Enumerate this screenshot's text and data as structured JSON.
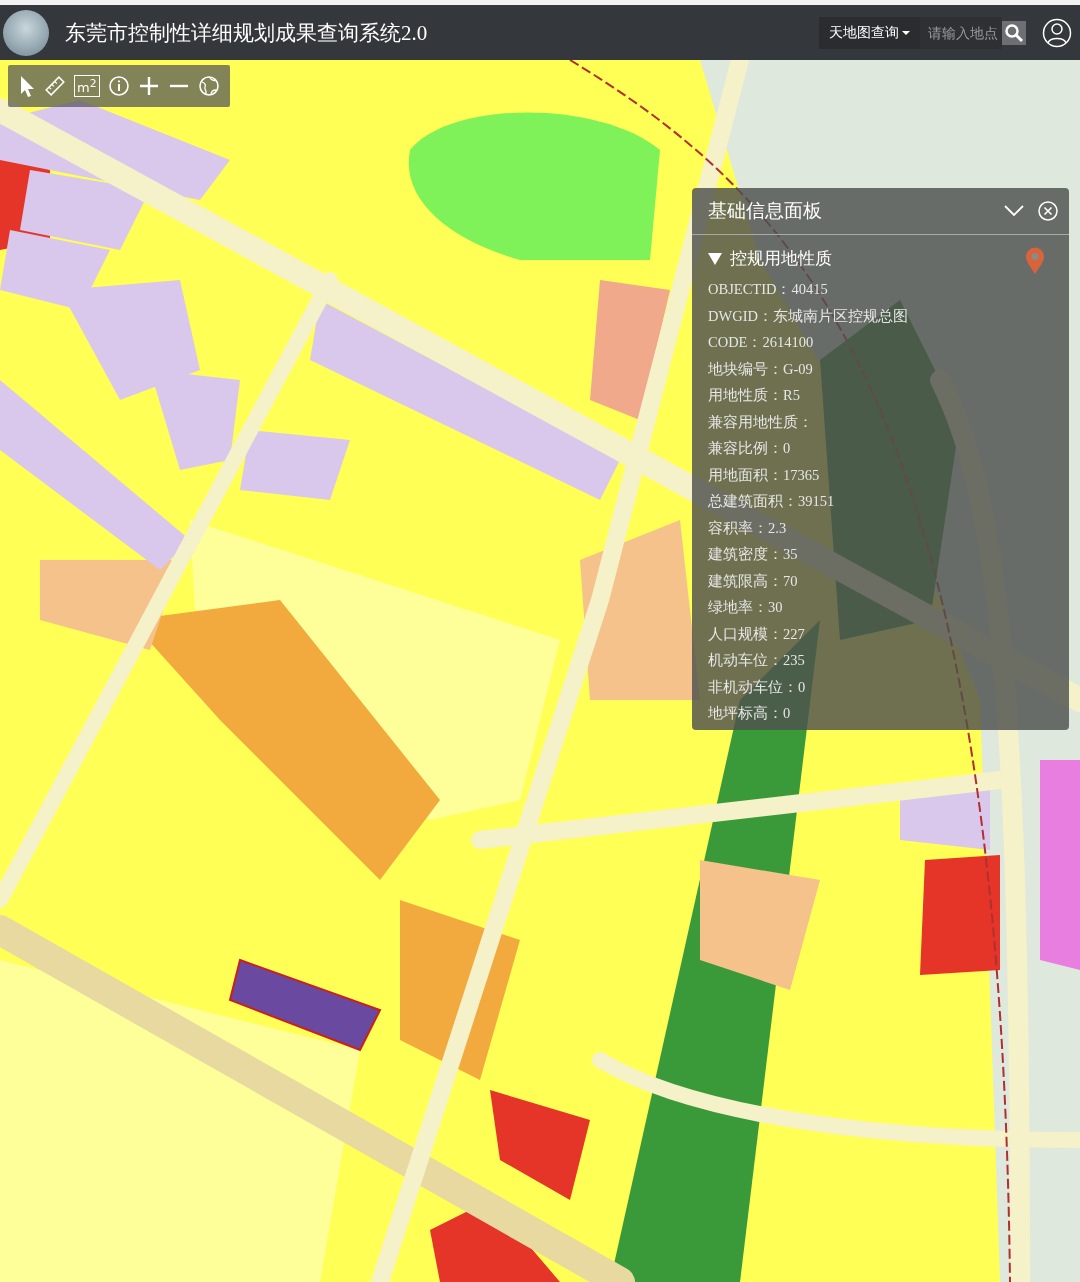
{
  "header": {
    "title": "东莞市控制性详细规划成果查询系统2.0",
    "search_mode": "天地图查询",
    "search": {
      "placeholder": "请输入地点"
    }
  },
  "toolbar": {
    "tools": [
      {
        "kind": "pointer"
      },
      {
        "kind": "ruler"
      },
      {
        "kind": "area",
        "label": "m$^{2}$"
      },
      {
        "kind": "info"
      },
      {
        "kind": "zoom-in"
      },
      {
        "kind": "zoom-out"
      },
      {
        "kind": "globe"
      }
    ]
  },
  "info_panel": {
    "title": "基础信息面板",
    "section": {
      "title": "控规用地性质",
      "expanded": true,
      "fields": [
        {
          "label": "OBJECTID：",
          "value": "40415"
        },
        {
          "label": "DWGID：",
          "value": "东城南片区控规总图"
        },
        {
          "label": "CODE：",
          "value": "2614100"
        },
        {
          "label": "地块编号：",
          "value": "G-09"
        },
        {
          "label": "用地性质：",
          "value": "R5"
        },
        {
          "label": "兼容用地性质："
        },
        {
          "label": "兼容比例：",
          "value": "0"
        },
        {
          "label": "用地面积：",
          "value": "17365"
        },
        {
          "label": "总建筑面积：",
          "value": "39151"
        },
        {
          "label": "容积率：",
          "value": "2.3"
        },
        {
          "label": "建筑密度：",
          "value": "35"
        },
        {
          "label": "建筑限高：",
          "value": "70"
        },
        {
          "label": "绿地率：",
          "value": "30"
        },
        {
          "label": "人口规模：",
          "value": "227"
        },
        {
          "label": "机动车位：",
          "value": "235"
        },
        {
          "label": "非机动车位：",
          "value": "0"
        },
        {
          "label": "地坪标高：",
          "value": "0"
        }
      ]
    }
  }
}
